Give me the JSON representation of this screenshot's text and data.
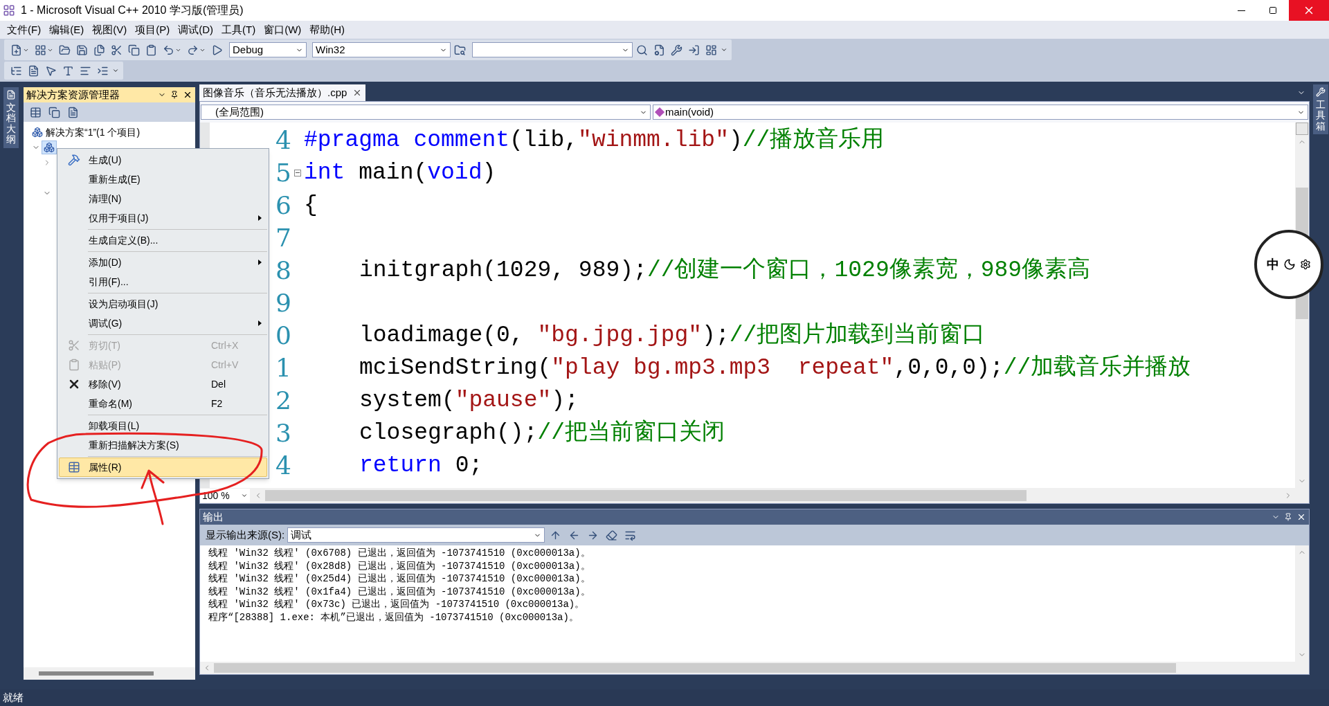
{
  "window": {
    "title": "1 - Microsoft Visual C++ 2010 学习版(管理员)"
  },
  "menu_bar": [
    "文件(F)",
    "编辑(E)",
    "视图(V)",
    "项目(P)",
    "调试(D)",
    "工具(T)",
    "窗口(W)",
    "帮助(H)"
  ],
  "toolbar": {
    "configuration": "Debug",
    "platform": "Win32"
  },
  "left_tab": "文档大纲",
  "right_tab": "工具箱",
  "solution_explorer": {
    "title": "解决方案资源管理器",
    "tree": [
      {
        "label": "解决方案“1”(1 个项目)",
        "selected": false,
        "children": [
          {
            "expanded": true,
            "selected": true,
            "children": [
              {
                "expanded": false,
                "selected": false
              },
              {
                "selected": false
              },
              {
                "expanded": true,
                "selected": false
              }
            ]
          }
        ]
      }
    ]
  },
  "editor": {
    "tab": {
      "label": "图像音乐（音乐无法播放）.cpp",
      "selected": true
    },
    "scope": "(全局范围)",
    "function": "main(void)",
    "zoom": "100 %",
    "lines": [
      {
        "number": "4",
        "indented": false,
        "collapsible": false,
        "tokens": [
          {
            "kind": "keyword",
            "text": "#pragma comment"
          },
          {
            "kind": "plain",
            "text": "(lib,"
          },
          {
            "kind": "string",
            "text": "\"winmm.lib\""
          },
          {
            "kind": "plain",
            "text": ")"
          },
          {
            "kind": "comment",
            "text": "//播放音乐用"
          }
        ]
      },
      {
        "number": "5",
        "indented": false,
        "collapsible": true,
        "tokens": [
          {
            "kind": "keyword",
            "text": "int"
          },
          {
            "kind": "plain",
            "text": " main("
          },
          {
            "kind": "keyword",
            "text": "void"
          },
          {
            "kind": "plain",
            "text": ")"
          }
        ]
      },
      {
        "number": "6",
        "indented": false,
        "collapsible": false,
        "tokens": [
          {
            "kind": "plain",
            "text": "{"
          }
        ]
      },
      {
        "number": "7",
        "collapsible": false
      },
      {
        "number": "8",
        "indented": true,
        "collapsible": false,
        "tokens": [
          {
            "kind": "plain",
            "text": "initgraph(1029, 989);"
          },
          {
            "kind": "comment",
            "text": "//创建一个窗口，1029像素宽，989像素高"
          }
        ]
      },
      {
        "number": "9",
        "collapsible": false
      },
      {
        "number": "0",
        "indented": true,
        "collapsible": false,
        "tokens": [
          {
            "kind": "plain",
            "text": "loadimage(0, "
          },
          {
            "kind": "string",
            "text": "\"bg.jpg.jpg\""
          },
          {
            "kind": "plain",
            "text": ");"
          },
          {
            "kind": "comment",
            "text": "//把图片加载到当前窗口"
          }
        ]
      },
      {
        "number": "1",
        "indented": true,
        "collapsible": false,
        "tokens": [
          {
            "kind": "plain",
            "text": "mciSendString("
          },
          {
            "kind": "string",
            "text": "\"play bg.mp3.mp3  repeat\""
          },
          {
            "kind": "plain",
            "text": ",0,0,0);"
          },
          {
            "kind": "comment",
            "text": "//加载音乐并播放"
          }
        ]
      },
      {
        "number": "2",
        "indented": true,
        "collapsible": false,
        "tokens": [
          {
            "kind": "plain",
            "text": "system("
          },
          {
            "kind": "string",
            "text": "\"pause\""
          },
          {
            "kind": "plain",
            "text": ");"
          }
        ]
      },
      {
        "number": "3",
        "indented": true,
        "collapsible": false,
        "tokens": [
          {
            "kind": "plain",
            "text": "closegraph();"
          },
          {
            "kind": "comment",
            "text": "//把当前窗口关闭"
          }
        ]
      },
      {
        "number": "4",
        "indented": true,
        "collapsible": false,
        "tokens": [
          {
            "kind": "keyword",
            "text": "return"
          },
          {
            "kind": "plain",
            "text": " 0;"
          }
        ]
      }
    ]
  },
  "context_menu": {
    "items": [
      {
        "kind": "item",
        "label": "生成(U)",
        "submenu": false,
        "disabled": false,
        "selected": false
      },
      {
        "kind": "item",
        "label": "重新生成(E)",
        "submenu": false,
        "disabled": false,
        "selected": false
      },
      {
        "kind": "item",
        "label": "清理(N)",
        "submenu": false,
        "disabled": false,
        "selected": false
      },
      {
        "kind": "item",
        "label": "仅用于项目(J)",
        "submenu": true,
        "disabled": false,
        "selected": false
      },
      {
        "kind": "separator"
      },
      {
        "kind": "item",
        "label": "生成自定义(B)...",
        "submenu": false,
        "disabled": false,
        "selected": false
      },
      {
        "kind": "separator"
      },
      {
        "kind": "item",
        "label": "添加(D)",
        "submenu": true,
        "disabled": false,
        "selected": false
      },
      {
        "kind": "item",
        "label": "引用(F)...",
        "submenu": false,
        "disabled": false,
        "selected": false
      },
      {
        "kind": "separator"
      },
      {
        "kind": "item",
        "label": "设为启动项目(J)",
        "submenu": false,
        "disabled": false,
        "selected": false
      },
      {
        "kind": "item",
        "label": "调试(G)",
        "submenu": true,
        "disabled": false,
        "selected": false
      },
      {
        "kind": "separator"
      },
      {
        "kind": "item",
        "label": "剪切(T)",
        "shortcut": "Ctrl+X",
        "submenu": false,
        "disabled": true,
        "selected": false
      },
      {
        "kind": "item",
        "label": "粘贴(P)",
        "shortcut": "Ctrl+V",
        "submenu": false,
        "disabled": true,
        "selected": false
      },
      {
        "kind": "item",
        "label": "移除(V)",
        "shortcut": "Del",
        "submenu": false,
        "disabled": false,
        "selected": false
      },
      {
        "kind": "item",
        "label": "重命名(M)",
        "shortcut": "F2",
        "submenu": false,
        "disabled": false,
        "selected": false
      },
      {
        "kind": "separator"
      },
      {
        "kind": "item",
        "label": "卸载项目(L)",
        "submenu": false,
        "disabled": false,
        "selected": false
      },
      {
        "kind": "item",
        "label": "重新扫描解决方案(S)",
        "submenu": false,
        "disabled": false,
        "selected": false
      },
      {
        "kind": "separator"
      },
      {
        "kind": "item",
        "label": "属性(R)",
        "submenu": false,
        "disabled": false,
        "selected": true
      }
    ]
  },
  "output": {
    "title": "输出",
    "source_label": "显示输出来源(S):",
    "source": "调试",
    "lines": [
      "线程 'Win32 线程' (0x6708) 已退出，返回值为 -1073741510 (0xc000013a)。",
      "线程 'Win32 线程' (0x28d8) 已退出，返回值为 -1073741510 (0xc000013a)。",
      "线程 'Win32 线程' (0x25d4) 已退出，返回值为 -1073741510 (0xc000013a)。",
      "线程 'Win32 线程' (0x1fa4) 已退出，返回值为 -1073741510 (0xc000013a)。",
      "线程 'Win32 线程' (0x73c) 已退出，返回值为 -1073741510 (0xc000013a)。",
      "程序“[28388] 1.exe: 本机”已退出，返回值为 -1073741510 (0xc000013a)。"
    ]
  },
  "ime": {
    "mode": "中"
  },
  "status_bar": "就绪"
}
